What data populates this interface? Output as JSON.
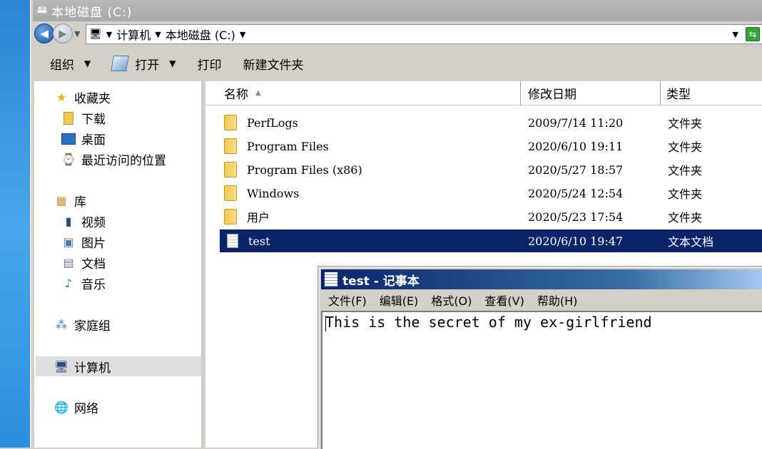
{
  "explorer": {
    "title": "本地磁盘 (C:)",
    "address": {
      "crumbs": [
        "计算机",
        "本地磁盘 (C:)"
      ]
    },
    "toolbar": {
      "organize": "组织",
      "open": "打开",
      "print": "打印",
      "new_folder": "新建文件夹"
    },
    "nav": {
      "favorites": "收藏夹",
      "downloads": "下载",
      "desktop": "桌面",
      "recent": "最近访问的位置",
      "libraries": "库",
      "videos": "视频",
      "pictures": "图片",
      "documents": "文档",
      "music": "音乐",
      "homegroup": "家庭组",
      "computer": "计算机",
      "network": "网络"
    },
    "columns": {
      "name": "名称",
      "modified": "修改日期",
      "type": "类型"
    },
    "files": [
      {
        "name": "PerfLogs",
        "date": "2009/7/14 11:20",
        "type": "文件夹"
      },
      {
        "name": "Program Files",
        "date": "2020/6/10 19:11",
        "type": "文件夹"
      },
      {
        "name": "Program Files (x86)",
        "date": "2020/5/27 18:57",
        "type": "文件夹"
      },
      {
        "name": "Windows",
        "date": "2020/5/24 12:54",
        "type": "文件夹"
      },
      {
        "name": "用户",
        "date": "2020/5/23 17:54",
        "type": "文件夹"
      },
      {
        "name": "test",
        "date": "2020/6/10 19:47",
        "type": "文本文档"
      }
    ]
  },
  "notepad": {
    "title": "test - 记事本",
    "menu": [
      "文件(F)",
      "编辑(E)",
      "格式(O)",
      "查看(V)",
      "帮助(H)"
    ],
    "content": "This is the secret of my ex-girlfriend"
  },
  "colors": {
    "selection": "#0a246a",
    "desktop": "#2a86d6"
  }
}
